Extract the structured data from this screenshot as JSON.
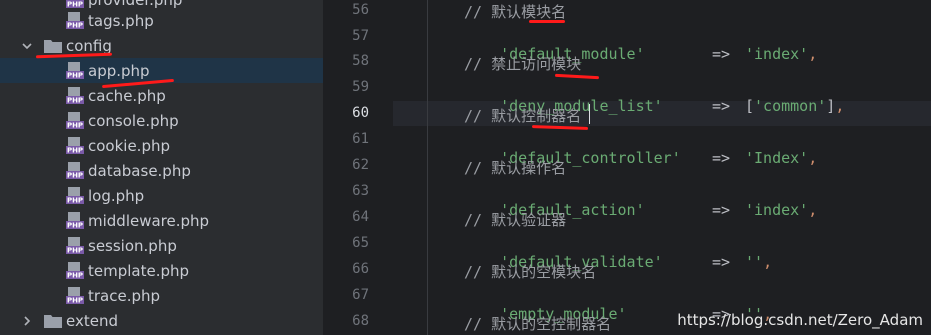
{
  "tree": {
    "items": [
      {
        "label": "provider.php",
        "type": "file"
      },
      {
        "label": "tags.php",
        "type": "file"
      },
      {
        "label": "config",
        "type": "folder"
      },
      {
        "label": "app.php",
        "type": "file"
      },
      {
        "label": "cache.php",
        "type": "file"
      },
      {
        "label": "console.php",
        "type": "file"
      },
      {
        "label": "cookie.php",
        "type": "file"
      },
      {
        "label": "database.php",
        "type": "file"
      },
      {
        "label": "log.php",
        "type": "file"
      },
      {
        "label": "middleware.php",
        "type": "file"
      },
      {
        "label": "session.php",
        "type": "file"
      },
      {
        "label": "template.php",
        "type": "file"
      },
      {
        "label": "trace.php",
        "type": "file"
      },
      {
        "label": "extend",
        "type": "folder"
      }
    ],
    "selected": "app.php",
    "icon_text": "PHP"
  },
  "editor": {
    "current_line": "60",
    "lines": [
      {
        "num": "56",
        "comment": "// 默认模块名"
      },
      {
        "num": "57",
        "key": "'default_module'",
        "arrow": "=>",
        "value": "'index'",
        "comma": ","
      },
      {
        "num": "58",
        "comment": "// 禁止访问模块"
      },
      {
        "num": "59",
        "key": "'deny_module_list'",
        "arrow": "=>",
        "open": "[",
        "value": "'common'",
        "close": "]",
        "comma": ","
      },
      {
        "num": "60",
        "comment": "// 默认控制器名"
      },
      {
        "num": "61",
        "key": "'default_controller'",
        "arrow": "=>",
        "value": "'Index'",
        "comma": ","
      },
      {
        "num": "62",
        "comment": "// 默认操作名"
      },
      {
        "num": "63",
        "key": "'default_action'",
        "arrow": "=>",
        "value": "'index'",
        "comma": ","
      },
      {
        "num": "64",
        "comment": "// 默认验证器"
      },
      {
        "num": "65",
        "key": "'default_validate'",
        "arrow": "=>",
        "value": "''",
        "comma": ","
      },
      {
        "num": "66",
        "comment": "// 默认的空模块名"
      },
      {
        "num": "67",
        "key": "'empty_module'",
        "arrow": "=>",
        "value": "''",
        "comma": ","
      },
      {
        "num": "68",
        "comment": "// 默认的空控制器名"
      }
    ]
  },
  "watermark": "https://blog.csdn.net/Zero_Adam",
  "colors": {
    "tree_bg": "#2b2d30",
    "editor_bg": "#1e1f22",
    "selection": "#1f3447",
    "string": "#6aab73",
    "comment": "#9a9da3",
    "annotation_red": "#ff1a1a"
  }
}
